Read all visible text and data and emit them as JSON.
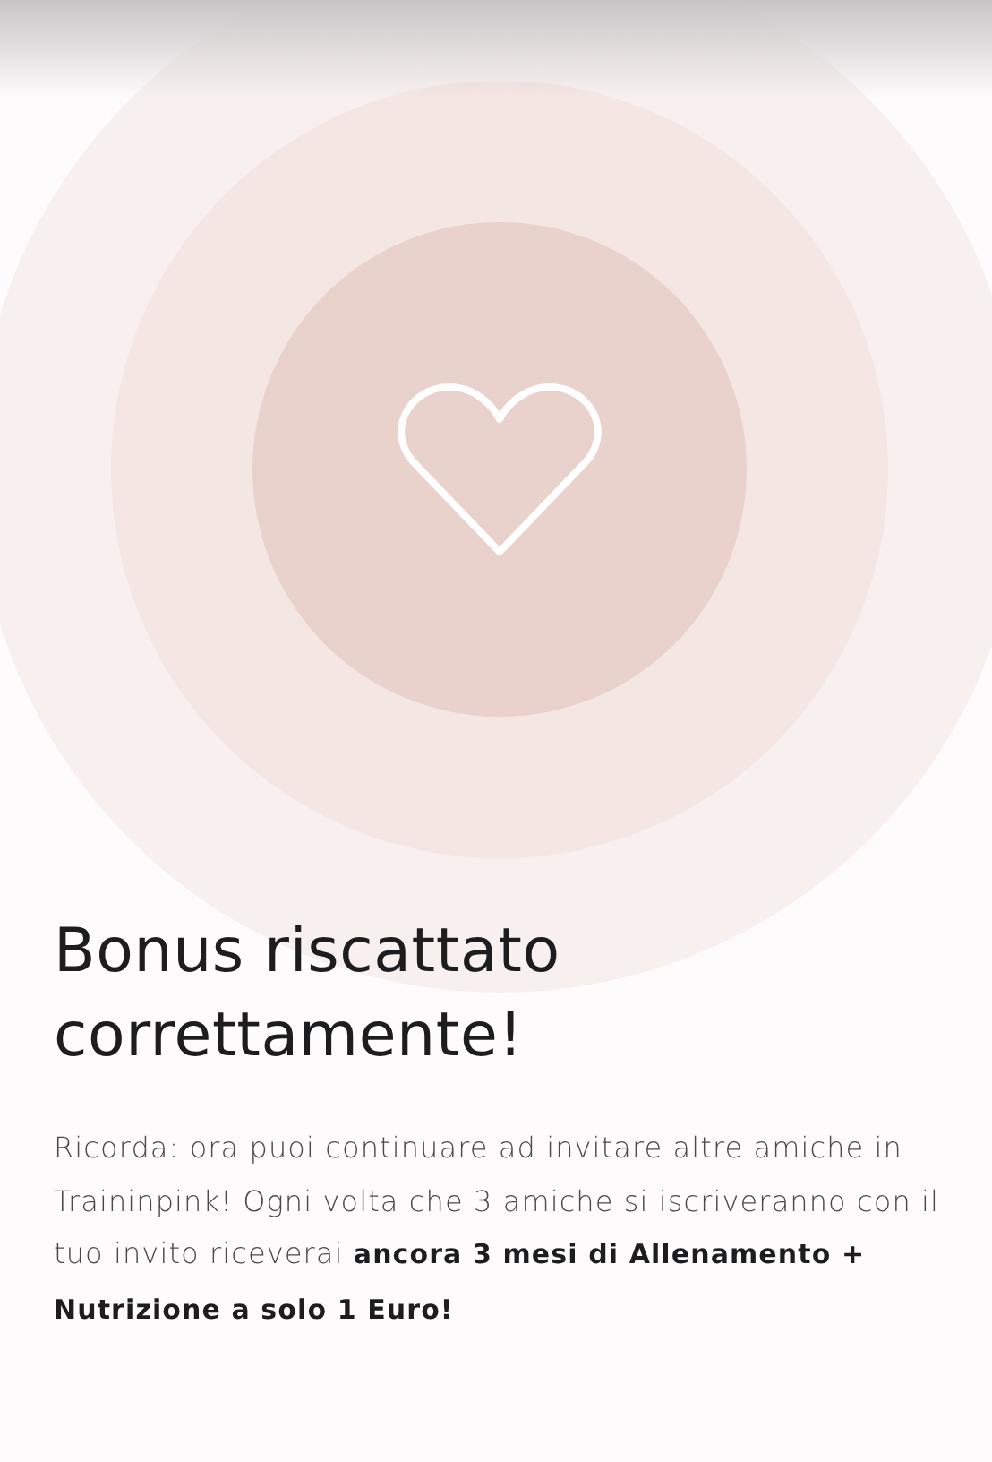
{
  "title": "Bonus riscattato correttamente!",
  "message": "Ricorda: ora puoi continuare ad invitare altre amiche in Traininpink! Ogni volta che 3 amiche si iscriveranno con il tuo invito riceverai **ancora 3 mesi di Allenamento + Nutrizione a solo 1 Euro!**"
}
